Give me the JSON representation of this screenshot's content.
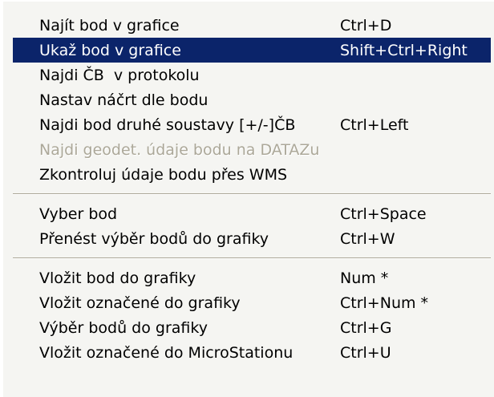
{
  "menu": {
    "group1": [
      {
        "label": "Najít bod v grafice",
        "shortcut": "Ctrl+D"
      },
      {
        "label": "Ukaž bod v grafice",
        "shortcut": "Shift+Ctrl+Right"
      },
      {
        "label": "Najdi ČB  v protokolu",
        "shortcut": ""
      },
      {
        "label": "Nastav náčrt dle bodu",
        "shortcut": ""
      },
      {
        "label": "Najdi bod druhé soustavy [+/-]ČB",
        "shortcut": "Ctrl+Left"
      },
      {
        "label": "Najdi geodet. údaje bodu na DATAZu",
        "shortcut": ""
      },
      {
        "label": "Zkontroluj údaje bodu přes WMS",
        "shortcut": ""
      }
    ],
    "group2": [
      {
        "label": "Vyber bod",
        "shortcut": "Ctrl+Space"
      },
      {
        "label": "Přenést výběr bodů do grafiky",
        "shortcut": "Ctrl+W"
      }
    ],
    "group3": [
      {
        "label": "Vložit bod do grafiky",
        "shortcut": "Num *"
      },
      {
        "label": "Vložit označené do grafiky",
        "shortcut": "Ctrl+Num *"
      },
      {
        "label": "Výběr bodů do grafiky",
        "shortcut": "Ctrl+G"
      },
      {
        "label": "Vložit označené do MicroStationu",
        "shortcut": "Ctrl+U"
      }
    ]
  },
  "colors": {
    "menu_background": "#f5f5f2",
    "selection_background": "#0b246a",
    "selection_text": "#ffffff",
    "disabled_text": "#aca899"
  }
}
